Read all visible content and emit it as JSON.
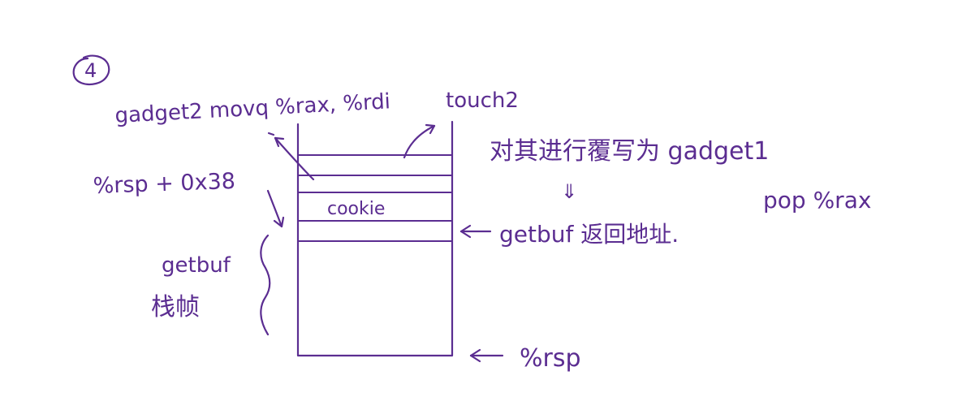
{
  "diagram": {
    "step_number": "4",
    "gadget2_label": "gadget2 movq %rax, %rdi",
    "touch2_label": "touch2",
    "overwrite_note": "对其进行覆写为 gadget1",
    "down_arrow": "⇓",
    "pop_label": "pop %rax",
    "rsp_offset_label": "%rsp + 0x38",
    "cookie_label": "cookie",
    "getbuf_return_label": "getbuf 返回地址.",
    "getbuf_frame_label": "getbuf",
    "frame_label": "栈帧",
    "rsp_label": "%rsp",
    "ink_color": "#5b2d91"
  }
}
